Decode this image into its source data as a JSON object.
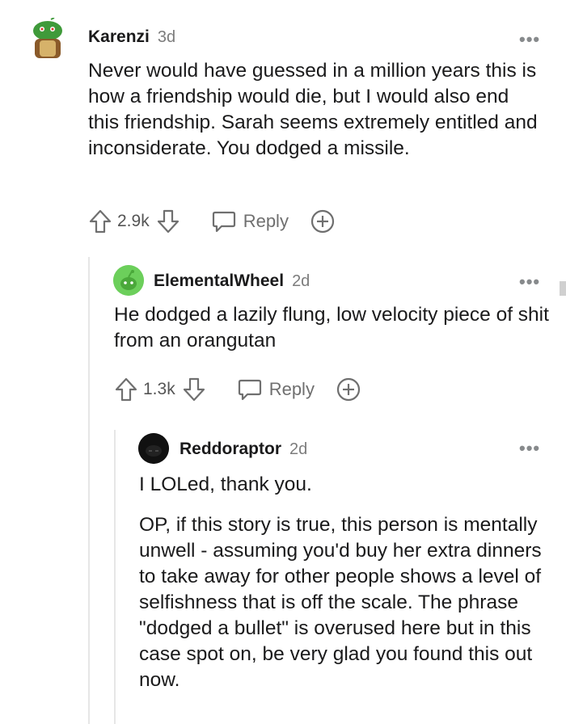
{
  "comments": [
    {
      "username": "Karenzi",
      "age": "3d",
      "paragraphs": [
        "Never would have guessed in a million years this is how a friendship would die, but I would also end this friendship. Sarah seems extremely entitled and inconsiderate. You dodged a missile."
      ],
      "score": "2.9k",
      "reply_label": "Reply",
      "more_label": "•••"
    },
    {
      "username": "ElementalWheel",
      "age": "2d",
      "paragraphs": [
        "He dodged a lazily flung, low velocity piece of shit from an orangutan"
      ],
      "score": "1.3k",
      "reply_label": "Reply",
      "more_label": "•••"
    },
    {
      "username": "Reddoraptor",
      "age": "2d",
      "paragraphs": [
        "I LOLed, thank you.",
        "OP, if this story is true, this person is mentally unwell - assuming you'd buy her extra dinners to take away for other people shows a level of selfishness that is off the scale. The phrase \"dodged a bullet\" is overused here but in this case spot on, be very glad you found this out now."
      ],
      "more_label": "•••"
    }
  ],
  "icons": {
    "upvote": "upvote-arrow-icon",
    "downvote": "downvote-arrow-icon",
    "reply": "speech-bubble-icon",
    "award": "plus-circle-icon"
  },
  "colors": {
    "text": "#1a1a1b",
    "muted": "#7c7c7c",
    "avatar_green": "#6ccf5b",
    "avatar_dark": "#111111"
  }
}
